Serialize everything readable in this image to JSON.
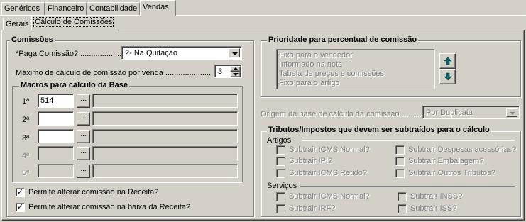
{
  "tabs": [
    "Genéricos",
    "Financeiro",
    "Contabilidade",
    "Vendas"
  ],
  "subtabs": [
    "Gerais",
    "Cálculo de Comissões"
  ],
  "comissoes": {
    "title": "Comissões",
    "paga_label": "*Paga Comissão? ........................",
    "paga_value": "2- Na Quitação",
    "max_label": "Máximo de cálculo de comissão por venda ..........................",
    "max_value": "3",
    "macros": {
      "title": "Macros para cálculo da Base",
      "rows": [
        {
          "label": "1ª",
          "value": "514",
          "btn": "..."
        },
        {
          "label": "2ª",
          "value": "",
          "btn": "..."
        },
        {
          "label": "3ª",
          "value": "",
          "btn": "..."
        },
        {
          "label": "4ª",
          "value": "",
          "btn": "..."
        },
        {
          "label": "5ª",
          "value": "",
          "btn": "..."
        }
      ]
    },
    "check1": "Permite alterar comissão na Receita?",
    "check2": "Permite alterar comissão na baixa da Receita?"
  },
  "prioridade": {
    "title": "Prioridade para percentual de comissão",
    "items": [
      "Fixo para o vendedor",
      "Informado na nota",
      "Tabela de preços e comissões",
      "Fixo para o artigo"
    ]
  },
  "origem": {
    "label": "Origem da base de cálculo da comissão ...............",
    "value": "Por Duplicata"
  },
  "tributos": {
    "title": "Tributos/Impostos que devem ser subtraídos para o cálculo",
    "artigos_title": "Artigos",
    "artigos_left": [
      "Subtrair ICMS Normal?",
      "Subtrair IPI?",
      "Subtrair ICMS Retido?"
    ],
    "artigos_right": [
      "Subtrair Despesas acessórias?",
      "Subtrair Embalagem?",
      "Subtrair Outros Tributos?"
    ],
    "servicos_title": "Serviços",
    "servicos_left": [
      "Subtrair ICMS Normal?",
      "Subtrair IRF?"
    ],
    "servicos_right": [
      "Subtrair INSS?",
      "Subtrair ISS?"
    ]
  },
  "colors": {
    "arrow_button_green": "#006666"
  }
}
